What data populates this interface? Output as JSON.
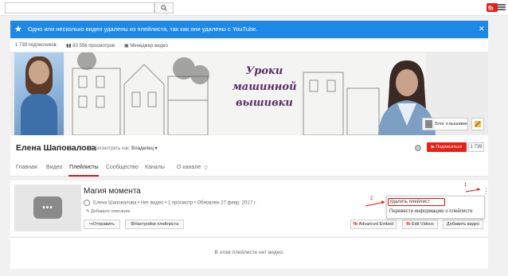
{
  "search": {
    "value": "",
    "placeholder": ""
  },
  "notice": {
    "text": "Одно или несколько видео удалены из плейлиста, так как они удалены с YouTube.",
    "close": "✕"
  },
  "stats": {
    "subscribers": "1 739 подписчиков",
    "views": "83 556 просмотров",
    "manager": "Менеджер видео"
  },
  "banner": {
    "title_lines": [
      "Уроки",
      "машинной",
      "вышивки"
    ],
    "blog_link": "Блог о вышивке"
  },
  "channel": {
    "name": "Елена Шаповалова",
    "view_as_label": "Просмотреть как:",
    "view_as_value": "Владелец ▾",
    "subscribe": "Подписаться",
    "sub_count": "1 739"
  },
  "tabs": [
    "Главная",
    "Видео",
    "Плейлисты",
    "Сообщество",
    "Каналы",
    "О канале"
  ],
  "playlist": {
    "title": "Магия момента",
    "meta": "Елена Шаповалова • Нет видео • 1 просмотр • Обновлен 27 февр. 2017 г.",
    "add_description": "Добавьте описание",
    "share": "Отправить",
    "settings": "Настройки плейлиста",
    "advanced_embed": "Advanced Embed",
    "edit_videos": "Edit Videos",
    "add_video": "Добавить видео",
    "annotation_1": "1",
    "annotation_2": "2"
  },
  "dropdown": {
    "delete": "Удалить плейлист",
    "translate": "Перевести информацию о плейлисте"
  },
  "empty": {
    "text": "В этом плейлисте нет видео."
  },
  "colors": {
    "accent": "#1e88e5",
    "red": "#e62117",
    "annotation": "#dd1111"
  }
}
